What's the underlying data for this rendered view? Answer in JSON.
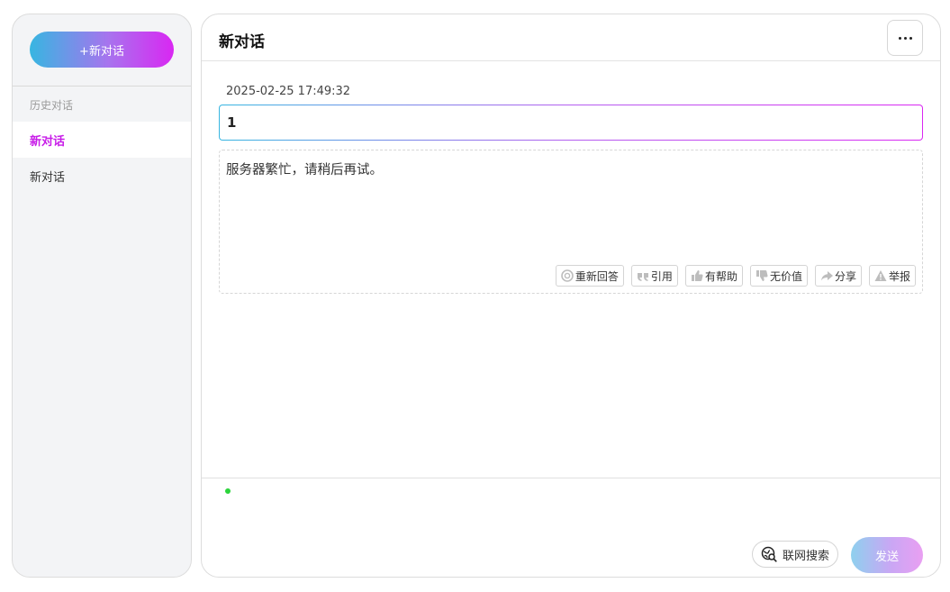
{
  "sidebar": {
    "new_chat_label": "+新对话",
    "history_label": "历史对话",
    "items": [
      {
        "label": "新对话"
      },
      {
        "label": "新对话"
      }
    ]
  },
  "header": {
    "title": "新对话",
    "more_icon": "ellipsis-icon"
  },
  "conversation": {
    "timestamp": "2025-02-25 17:49:32",
    "user_message": "1",
    "reply_text": "服务器繁忙，请稍后再试。",
    "actions": [
      {
        "label": "重新回答",
        "icon": "regenerate-icon"
      },
      {
        "label": "引用",
        "icon": "quote-icon"
      },
      {
        "label": "有帮助",
        "icon": "thumbs-up-icon"
      },
      {
        "label": "无价值",
        "icon": "thumbs-down-icon"
      },
      {
        "label": "分享",
        "icon": "share-icon"
      },
      {
        "label": "举报",
        "icon": "warning-icon"
      }
    ]
  },
  "composer": {
    "status_color": "#2bd43b",
    "web_search_label": "联网搜索",
    "send_label": "发送"
  },
  "colors": {
    "accent": "#c81ee8",
    "gradient_start": "#37b6e1",
    "gradient_end": "#d927f2"
  }
}
